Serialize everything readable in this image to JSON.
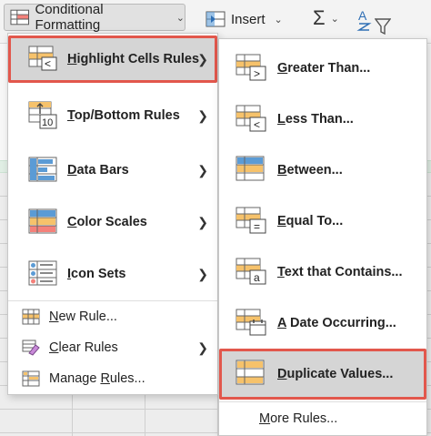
{
  "ribbon": {
    "conditional_formatting": "Conditional Formatting",
    "insert": "Insert"
  },
  "main_menu": {
    "items": [
      {
        "pre": "",
        "u": "H",
        "post": "ighlight Cells Rules",
        "icon": "highlight-cells-icon"
      },
      {
        "pre": "",
        "u": "T",
        "post": "op/Bottom Rules",
        "icon": "top-bottom-icon"
      },
      {
        "pre": "",
        "u": "D",
        "post": "ata Bars",
        "icon": "data-bars-icon"
      },
      {
        "pre": "",
        "u": "C",
        "post": "olor Scales",
        "icon": "color-scales-icon"
      },
      {
        "pre": "",
        "u": "I",
        "post": "con Sets",
        "icon": "icon-sets-icon"
      },
      {
        "pre": "",
        "u": "N",
        "post": "ew Rule...",
        "icon": "new-rule-icon"
      },
      {
        "pre": "",
        "u": "C",
        "post": "lear Rules",
        "icon": "clear-rules-icon"
      },
      {
        "pre": "Manage ",
        "u": "R",
        "post": "ules...",
        "icon": "manage-rules-icon"
      }
    ]
  },
  "sub_menu": {
    "items": [
      {
        "pre": "",
        "u": "G",
        "post": "reater Than...",
        "icon": "greater-than-icon"
      },
      {
        "pre": "",
        "u": "L",
        "post": "ess Than...",
        "icon": "less-than-icon"
      },
      {
        "pre": "",
        "u": "B",
        "post": "etween...",
        "icon": "between-icon"
      },
      {
        "pre": "",
        "u": "E",
        "post": "qual To...",
        "icon": "equal-to-icon"
      },
      {
        "pre": "",
        "u": "T",
        "post": "ext that Contains...",
        "icon": "text-contains-icon"
      },
      {
        "pre": "",
        "u": "A",
        "post": " Date Occurring...",
        "icon": "date-occurring-icon"
      },
      {
        "pre": "",
        "u": "D",
        "post": "uplicate Values...",
        "icon": "duplicate-values-icon"
      },
      {
        "pre": "",
        "u": "M",
        "post": "ore Rules...",
        "icon": "more-rules-icon"
      }
    ]
  },
  "colors": {
    "highlight_outline": "#e2574c",
    "active_background": "#d5d5d5",
    "icon_orange": "#f6c26b",
    "icon_blue": "#5b9bd5",
    "icon_red": "#f4817a"
  }
}
